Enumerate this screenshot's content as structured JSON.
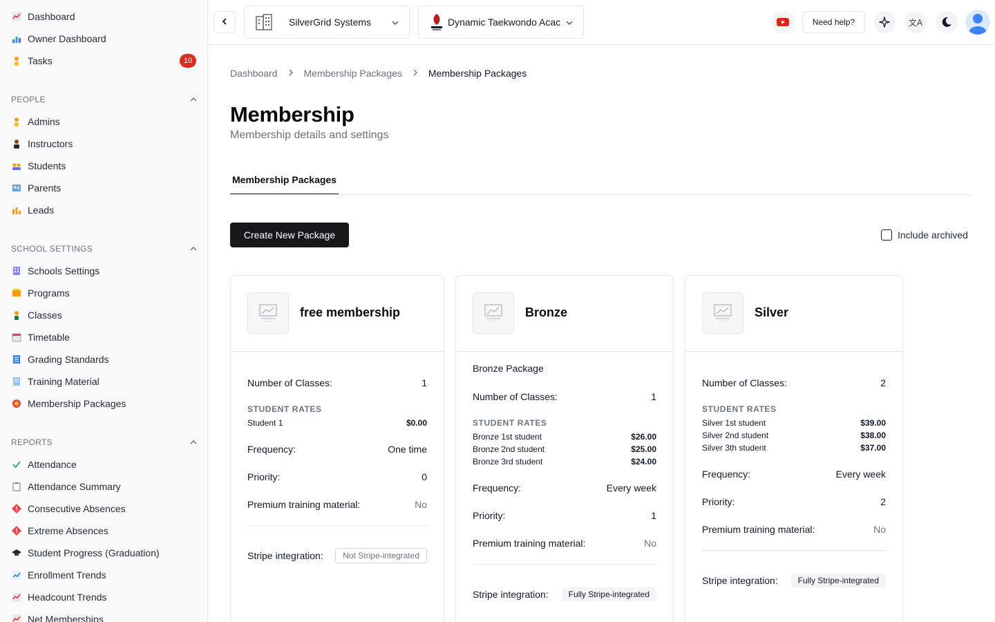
{
  "sidebar": {
    "top": [
      {
        "label": "Dashboard",
        "icon": "chart-line-icon"
      },
      {
        "label": "Owner Dashboard",
        "icon": "bar-chart-icon"
      },
      {
        "label": "Tasks",
        "icon": "person-icon",
        "badge": "10"
      }
    ],
    "people": {
      "title": "PEOPLE",
      "items": [
        {
          "label": "Admins",
          "icon": "admin-icon"
        },
        {
          "label": "Instructors",
          "icon": "instructor-icon"
        },
        {
          "label": "Students",
          "icon": "students-icon"
        },
        {
          "label": "Parents",
          "icon": "parents-icon"
        },
        {
          "label": "Leads",
          "icon": "leads-icon"
        }
      ]
    },
    "school_settings": {
      "title": "SCHOOL SETTINGS",
      "items": [
        {
          "label": "Schools Settings",
          "icon": "building-icon"
        },
        {
          "label": "Programs",
          "icon": "programs-icon"
        },
        {
          "label": "Classes",
          "icon": "classes-icon"
        },
        {
          "label": "Timetable",
          "icon": "calendar-icon"
        },
        {
          "label": "Grading Standards",
          "icon": "grading-icon"
        },
        {
          "label": "Training Material",
          "icon": "document-icon"
        },
        {
          "label": "Membership Packages",
          "icon": "medal-icon"
        }
      ]
    },
    "reports": {
      "title": "REPORTS",
      "items": [
        {
          "label": "Attendance",
          "icon": "check-icon"
        },
        {
          "label": "Attendance Summary",
          "icon": "clipboard-icon"
        },
        {
          "label": "Consecutive Absences",
          "icon": "warning-diamond-icon"
        },
        {
          "label": "Extreme Absences",
          "icon": "warning-diamond-icon"
        },
        {
          "label": "Student Progress (Graduation)",
          "icon": "graduation-cap-icon"
        },
        {
          "label": "Enrollment Trends",
          "icon": "trend-icon"
        },
        {
          "label": "Headcount Trends",
          "icon": "chart-line-icon"
        },
        {
          "label": "Net Memberships",
          "icon": "chart-line-icon"
        }
      ]
    }
  },
  "topbar": {
    "org_name": "SilverGrid Systems",
    "school_name": "Dynamic Taekwondo Acac",
    "help_label": "Need help?"
  },
  "breadcrumb": [
    "Dashboard",
    "Membership Packages",
    "Membership Packages"
  ],
  "page": {
    "title": "Membership",
    "subtitle": "Membership details and settings",
    "tab": "Membership Packages",
    "create_button": "Create New Package",
    "include_archived": "Include archived"
  },
  "labels": {
    "classes": "Number of Classes:",
    "rates": "STUDENT RATES",
    "frequency": "Frequency:",
    "priority": "Priority:",
    "premium": "Premium training material:",
    "stripe": "Stripe integration:"
  },
  "cards": [
    {
      "title": "free membership",
      "description": "",
      "classes": "1",
      "rates": [
        {
          "name": "Student 1",
          "price": "$0.00"
        }
      ],
      "frequency": "One time",
      "priority": "0",
      "premium": "No",
      "stripe": "Not Stripe-integrated",
      "stripe_style": "outline"
    },
    {
      "title": "Bronze",
      "description": "Bronze Package",
      "classes": "1",
      "rates": [
        {
          "name": "Bronze 1st student",
          "price": "$26.00"
        },
        {
          "name": "Bronze 2nd student",
          "price": "$25.00"
        },
        {
          "name": "Bronze 3rd student",
          "price": "$24.00"
        }
      ],
      "frequency": "Every week",
      "priority": "1",
      "premium": "No",
      "stripe": "Fully Stripe-integrated",
      "stripe_style": "filled"
    },
    {
      "title": "Silver",
      "description": "",
      "classes": "2",
      "rates": [
        {
          "name": "Silver 1st student",
          "price": "$39.00"
        },
        {
          "name": "Silver 2nd student",
          "price": "$38.00"
        },
        {
          "name": "Silver 3th student",
          "price": "$37.00"
        }
      ],
      "frequency": "Every week",
      "priority": "2",
      "premium": "No",
      "stripe": "Fully Stripe-integrated",
      "stripe_style": "filled"
    }
  ],
  "colors": {
    "accent": "#18181b",
    "badge": "#d92d20",
    "youtube": "#e62117",
    "avatar": "#3b82f6"
  }
}
